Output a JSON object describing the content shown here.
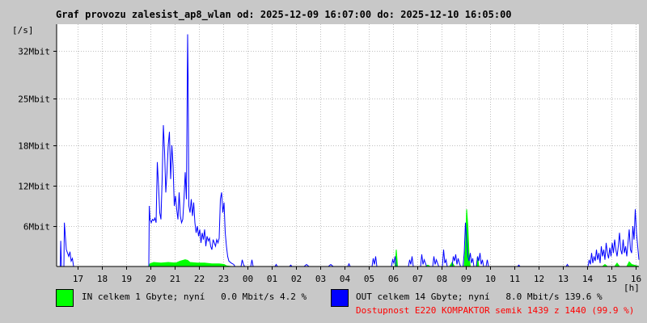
{
  "title": "Graf provozu zalesist_ap8_wlan od: 2025-12-09 16:07:00 do: 2025-12-10 16:05:00",
  "colors": {
    "background": "#c8c8c8",
    "plot_bg": "#ffffff",
    "grid": "#c0c0c0",
    "in_series": "#00ff00",
    "out_series": "#0000ff",
    "availability_text": "#ff0000"
  },
  "legend": {
    "in_label": "IN celkem 1 Gbyte; nyní   0.0 Mbit/s 4.2 %",
    "out_label": "OUT celkem 14 Gbyte; nyní   8.0 Mbit/s 139.6 %",
    "availability": "Dostupnost E220 KOMPAKTOR semik 1439 z 1440 (99.9 %)"
  },
  "chart_data": {
    "type": "area",
    "title": "Graf provozu zalesist_ap8_wlan od: 2025-12-09 16:07:00 do: 2025-12-10 16:05:00",
    "xlabel": "[h]",
    "ylabel": "[/s]",
    "x_unit": "hours since 2025-12-09 16:07",
    "xlim": [
      0,
      24
    ],
    "ylim": [
      0,
      36
    ],
    "y_unit": "Mbit/s",
    "grid": true,
    "y_ticks": [
      {
        "value": 6,
        "label": "6Mbit"
      },
      {
        "value": 12,
        "label": "12Mbit"
      },
      {
        "value": 18,
        "label": "18Mbit"
      },
      {
        "value": 25,
        "label": "25Mbit"
      },
      {
        "value": 32,
        "label": "32Mbit"
      }
    ],
    "x_ticks": [
      {
        "value": 0.88,
        "label": "17"
      },
      {
        "value": 1.88,
        "label": "18"
      },
      {
        "value": 2.88,
        "label": "19"
      },
      {
        "value": 3.88,
        "label": "20"
      },
      {
        "value": 4.88,
        "label": "21"
      },
      {
        "value": 5.88,
        "label": "22"
      },
      {
        "value": 6.88,
        "label": "23"
      },
      {
        "value": 7.88,
        "label": "00"
      },
      {
        "value": 8.88,
        "label": "01"
      },
      {
        "value": 9.88,
        "label": "02"
      },
      {
        "value": 10.88,
        "label": "03"
      },
      {
        "value": 11.88,
        "label": "04"
      },
      {
        "value": 12.88,
        "label": "05"
      },
      {
        "value": 13.88,
        "label": "06"
      },
      {
        "value": 14.88,
        "label": "07"
      },
      {
        "value": 15.88,
        "label": "08"
      },
      {
        "value": 16.88,
        "label": "09"
      },
      {
        "value": 17.88,
        "label": "10"
      },
      {
        "value": 18.88,
        "label": "11"
      },
      {
        "value": 19.88,
        "label": "12"
      },
      {
        "value": 20.88,
        "label": "13"
      },
      {
        "value": 21.88,
        "label": "14"
      },
      {
        "value": 22.88,
        "label": "15"
      },
      {
        "value": 23.88,
        "label": "16"
      }
    ],
    "series": [
      {
        "name": "IN",
        "color": "#00ff00",
        "style": "filled-area",
        "points": [
          [
            0,
            0
          ],
          [
            3.8,
            0
          ],
          [
            3.85,
            0.4
          ],
          [
            4.0,
            0.6
          ],
          [
            4.3,
            0.5
          ],
          [
            4.6,
            0.6
          ],
          [
            4.9,
            0.5
          ],
          [
            5.1,
            0.8
          ],
          [
            5.3,
            1.0
          ],
          [
            5.4,
            0.9
          ],
          [
            5.5,
            0.6
          ],
          [
            5.8,
            0.5
          ],
          [
            6.1,
            0.5
          ],
          [
            6.4,
            0.4
          ],
          [
            6.7,
            0.4
          ],
          [
            6.9,
            0.3
          ],
          [
            7.0,
            0.1
          ],
          [
            7.2,
            0
          ],
          [
            13.95,
            0
          ],
          [
            14.0,
            2.5
          ],
          [
            14.05,
            0
          ],
          [
            15.2,
            0
          ],
          [
            15.3,
            0.2
          ],
          [
            15.4,
            0
          ],
          [
            16.2,
            0
          ],
          [
            16.3,
            0.6
          ],
          [
            16.4,
            0
          ],
          [
            16.8,
            0
          ],
          [
            16.85,
            3.0
          ],
          [
            16.9,
            8.5
          ],
          [
            16.95,
            6.0
          ],
          [
            17.0,
            1.5
          ],
          [
            17.05,
            0
          ],
          [
            17.3,
            0
          ],
          [
            17.35,
            1.5
          ],
          [
            17.4,
            0
          ],
          [
            22.5,
            0
          ],
          [
            22.6,
            0.3
          ],
          [
            22.7,
            0
          ],
          [
            23.0,
            0
          ],
          [
            23.1,
            0.5
          ],
          [
            23.2,
            0
          ],
          [
            23.5,
            0
          ],
          [
            23.6,
            0.7
          ],
          [
            23.7,
            0.3
          ],
          [
            24,
            0
          ]
        ]
      },
      {
        "name": "OUT",
        "color": "#0000ff",
        "style": "line",
        "points": [
          [
            0,
            0
          ],
          [
            0.15,
            0
          ],
          [
            0.17,
            3.8
          ],
          [
            0.2,
            0
          ],
          [
            0.3,
            0
          ],
          [
            0.32,
            6.5
          ],
          [
            0.35,
            5.0
          ],
          [
            0.4,
            2.5
          ],
          [
            0.45,
            2.0
          ],
          [
            0.5,
            1.5
          ],
          [
            0.55,
            2.2
          ],
          [
            0.6,
            0.8
          ],
          [
            0.65,
            1.2
          ],
          [
            0.7,
            0
          ],
          [
            3.8,
            0
          ],
          [
            3.82,
            9.0
          ],
          [
            3.85,
            7.0
          ],
          [
            3.9,
            6.5
          ],
          [
            3.95,
            7.0
          ],
          [
            4.0,
            6.8
          ],
          [
            4.05,
            7.2
          ],
          [
            4.1,
            6.5
          ],
          [
            4.15,
            15.5
          ],
          [
            4.2,
            12.0
          ],
          [
            4.25,
            8.0
          ],
          [
            4.3,
            7.0
          ],
          [
            4.35,
            13.0
          ],
          [
            4.4,
            21.0
          ],
          [
            4.45,
            17.0
          ],
          [
            4.5,
            11.0
          ],
          [
            4.55,
            14.0
          ],
          [
            4.6,
            18.0
          ],
          [
            4.65,
            20.0
          ],
          [
            4.7,
            13.0
          ],
          [
            4.75,
            18.0
          ],
          [
            4.8,
            15.0
          ],
          [
            4.85,
            9.0
          ],
          [
            4.9,
            10.5
          ],
          [
            4.95,
            8.5
          ],
          [
            5.0,
            7.0
          ],
          [
            5.05,
            11.0
          ],
          [
            5.1,
            7.5
          ],
          [
            5.15,
            6.5
          ],
          [
            5.2,
            7.0
          ],
          [
            5.25,
            10.0
          ],
          [
            5.3,
            14.0
          ],
          [
            5.35,
            10.0
          ],
          [
            5.4,
            34.5
          ],
          [
            5.42,
            28.0
          ],
          [
            5.45,
            9.0
          ],
          [
            5.5,
            8.0
          ],
          [
            5.55,
            10.0
          ],
          [
            5.6,
            7.5
          ],
          [
            5.65,
            9.5
          ],
          [
            5.7,
            6.5
          ],
          [
            5.75,
            5.0
          ],
          [
            5.8,
            6.0
          ],
          [
            5.85,
            4.5
          ],
          [
            5.9,
            5.5
          ],
          [
            5.95,
            3.5
          ],
          [
            6.0,
            5.0
          ],
          [
            6.05,
            4.0
          ],
          [
            6.1,
            5.5
          ],
          [
            6.15,
            3.0
          ],
          [
            6.2,
            4.5
          ],
          [
            6.25,
            3.8
          ],
          [
            6.3,
            4.2
          ],
          [
            6.35,
            3.0
          ],
          [
            6.4,
            2.5
          ],
          [
            6.45,
            4.0
          ],
          [
            6.5,
            3.5
          ],
          [
            6.55,
            3.0
          ],
          [
            6.6,
            4.0
          ],
          [
            6.65,
            3.5
          ],
          [
            6.7,
            4.2
          ],
          [
            6.75,
            10.0
          ],
          [
            6.8,
            11.0
          ],
          [
            6.85,
            8.0
          ],
          [
            6.9,
            9.5
          ],
          [
            6.95,
            5.0
          ],
          [
            7.0,
            3.0
          ],
          [
            7.05,
            1.5
          ],
          [
            7.1,
            0.8
          ],
          [
            7.2,
            0.5
          ],
          [
            7.3,
            0.3
          ],
          [
            7.35,
            0
          ],
          [
            7.6,
            0
          ],
          [
            7.65,
            1.0
          ],
          [
            7.7,
            0.3
          ],
          [
            7.75,
            0
          ],
          [
            8.0,
            0
          ],
          [
            8.05,
            1.0
          ],
          [
            8.1,
            0
          ],
          [
            9.0,
            0
          ],
          [
            9.05,
            0.3
          ],
          [
            9.1,
            0
          ],
          [
            9.6,
            0
          ],
          [
            9.65,
            0.2
          ],
          [
            9.7,
            0
          ],
          [
            10.2,
            0
          ],
          [
            10.3,
            0.3
          ],
          [
            10.4,
            0
          ],
          [
            11.2,
            0
          ],
          [
            11.3,
            0.3
          ],
          [
            11.4,
            0
          ],
          [
            12.0,
            0
          ],
          [
            12.05,
            0.4
          ],
          [
            12.1,
            0
          ],
          [
            13.0,
            0
          ],
          [
            13.05,
            1.2
          ],
          [
            13.1,
            0.3
          ],
          [
            13.15,
            1.5
          ],
          [
            13.2,
            0
          ],
          [
            13.8,
            0
          ],
          [
            13.85,
            1.0
          ],
          [
            13.9,
            0.5
          ],
          [
            13.95,
            1.5
          ],
          [
            14.0,
            0
          ],
          [
            14.5,
            0
          ],
          [
            14.55,
            1.0
          ],
          [
            14.6,
            0.3
          ],
          [
            14.65,
            1.5
          ],
          [
            14.7,
            0
          ],
          [
            15.0,
            0
          ],
          [
            15.05,
            1.8
          ],
          [
            15.1,
            0.3
          ],
          [
            15.15,
            1.0
          ],
          [
            15.2,
            0.5
          ],
          [
            15.25,
            0
          ],
          [
            15.5,
            0
          ],
          [
            15.55,
            1.5
          ],
          [
            15.6,
            0.3
          ],
          [
            15.65,
            1.0
          ],
          [
            15.7,
            0.5
          ],
          [
            15.75,
            0
          ],
          [
            15.9,
            0
          ],
          [
            15.95,
            2.5
          ],
          [
            16.0,
            0.5
          ],
          [
            16.05,
            1.0
          ],
          [
            16.1,
            0
          ],
          [
            16.3,
            0
          ],
          [
            16.35,
            1.5
          ],
          [
            16.4,
            0.8
          ],
          [
            16.45,
            1.8
          ],
          [
            16.5,
            0.3
          ],
          [
            16.55,
            1.2
          ],
          [
            16.6,
            0.5
          ],
          [
            16.65,
            0
          ],
          [
            16.75,
            0
          ],
          [
            16.8,
            2.0
          ],
          [
            16.85,
            6.5
          ],
          [
            16.9,
            4.0
          ],
          [
            16.95,
            1.5
          ],
          [
            17.0,
            0.8
          ],
          [
            17.05,
            2.0
          ],
          [
            17.1,
            0.5
          ],
          [
            17.15,
            1.2
          ],
          [
            17.2,
            0
          ],
          [
            17.3,
            0
          ],
          [
            17.35,
            1.5
          ],
          [
            17.4,
            0.8
          ],
          [
            17.45,
            2.0
          ],
          [
            17.5,
            0.3
          ],
          [
            17.55,
            1.0
          ],
          [
            17.6,
            0
          ],
          [
            17.7,
            0
          ],
          [
            17.75,
            1.0
          ],
          [
            17.8,
            0
          ],
          [
            19.0,
            0
          ],
          [
            19.05,
            0.2
          ],
          [
            19.1,
            0
          ],
          [
            21.0,
            0
          ],
          [
            21.05,
            0.3
          ],
          [
            21.1,
            0
          ],
          [
            21.9,
            0
          ],
          [
            21.95,
            1.0
          ],
          [
            22.0,
            0.3
          ],
          [
            22.05,
            2.0
          ],
          [
            22.1,
            0.5
          ],
          [
            22.15,
            1.5
          ],
          [
            22.2,
            0.8
          ],
          [
            22.25,
            2.5
          ],
          [
            22.3,
            1.0
          ],
          [
            22.35,
            2.0
          ],
          [
            22.4,
            0.5
          ],
          [
            22.45,
            3.0
          ],
          [
            22.5,
            1.5
          ],
          [
            22.55,
            2.5
          ],
          [
            22.6,
            1.0
          ],
          [
            22.65,
            3.5
          ],
          [
            22.7,
            2.0
          ],
          [
            22.75,
            1.2
          ],
          [
            22.8,
            2.8
          ],
          [
            22.85,
            1.5
          ],
          [
            22.9,
            3.5
          ],
          [
            22.95,
            2.0
          ],
          [
            23.0,
            4.0
          ],
          [
            23.05,
            2.5
          ],
          [
            23.1,
            1.5
          ],
          [
            23.15,
            3.0
          ],
          [
            23.2,
            5.0
          ],
          [
            23.25,
            2.5
          ],
          [
            23.3,
            1.8
          ],
          [
            23.35,
            4.0
          ],
          [
            23.4,
            2.0
          ],
          [
            23.45,
            3.0
          ],
          [
            23.5,
            1.5
          ],
          [
            23.55,
            3.5
          ],
          [
            23.6,
            5.5
          ],
          [
            23.65,
            2.5
          ],
          [
            23.7,
            2.0
          ],
          [
            23.75,
            6.0
          ],
          [
            23.8,
            4.0
          ],
          [
            23.85,
            8.5
          ],
          [
            23.9,
            5.0
          ],
          [
            23.95,
            3.0
          ],
          [
            24,
            1.0
          ]
        ]
      }
    ]
  }
}
